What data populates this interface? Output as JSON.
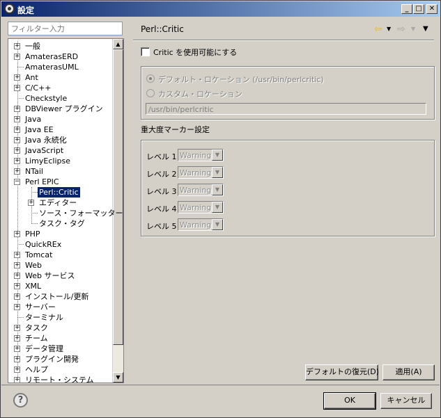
{
  "window": {
    "title": "設定",
    "minimize": "_",
    "maximize": "□",
    "close": "✕"
  },
  "filter": {
    "placeholder": "フィルター入力"
  },
  "tree": {
    "items": [
      {
        "label": "一般",
        "expandable": true
      },
      {
        "label": "AmaterasERD",
        "expandable": true
      },
      {
        "label": "AmaterasUML",
        "expandable": false
      },
      {
        "label": "Ant",
        "expandable": true
      },
      {
        "label": "C/C++",
        "expandable": true
      },
      {
        "label": "Checkstyle",
        "expandable": false
      },
      {
        "label": "DBViewer プラグイン",
        "expandable": true
      },
      {
        "label": "Java",
        "expandable": true
      },
      {
        "label": "Java EE",
        "expandable": true
      },
      {
        "label": "Java 永続化",
        "expandable": true
      },
      {
        "label": "JavaScript",
        "expandable": true
      },
      {
        "label": "LimyEclipse",
        "expandable": true
      },
      {
        "label": "NTail",
        "expandable": true
      },
      {
        "label": "Perl EPIC",
        "expandable": true,
        "expanded": true
      },
      {
        "label": "Perl::Critic",
        "child": true,
        "selected": true
      },
      {
        "label": "エディター",
        "child": true,
        "expandable": true
      },
      {
        "label": "ソース・フォーマッター",
        "child": true
      },
      {
        "label": "タスク・タグ",
        "child": true
      },
      {
        "label": "PHP",
        "expandable": true
      },
      {
        "label": "QuickREx",
        "expandable": false
      },
      {
        "label": "Tomcat",
        "expandable": true
      },
      {
        "label": "Web",
        "expandable": true
      },
      {
        "label": "Web サービス",
        "expandable": true
      },
      {
        "label": "XML",
        "expandable": true
      },
      {
        "label": "インストール/更新",
        "expandable": true
      },
      {
        "label": "サーバー",
        "expandable": true
      },
      {
        "label": "ターミナル",
        "expandable": false
      },
      {
        "label": "タスク",
        "expandable": true
      },
      {
        "label": "チーム",
        "expandable": true
      },
      {
        "label": "データ管理",
        "expandable": true
      },
      {
        "label": "プラグイン開発",
        "expandable": true
      },
      {
        "label": "ヘルプ",
        "expandable": true
      },
      {
        "label": "リモート・システム",
        "expandable": true
      }
    ]
  },
  "page": {
    "title": "Perl::Critic",
    "enable_label": "Critic を使用可能にする",
    "enable_checked": false,
    "location": {
      "default_label": "デフォルト・ロケーション (/usr/bin/perlcritic)",
      "custom_label": "カスタム・ロケーション",
      "path_value": "/usr/bin/perlcritic",
      "selected": "default"
    },
    "severity_title": "重大度マーカー設定",
    "levels": [
      {
        "label": "レベル 1",
        "value": "Warning"
      },
      {
        "label": "レベル 2",
        "value": "Warning"
      },
      {
        "label": "レベル 3",
        "value": "Warning"
      },
      {
        "label": "レベル 4",
        "value": "Warning"
      },
      {
        "label": "レベル 5",
        "value": "Warning"
      }
    ],
    "restore_defaults": "デフォルトの復元(D)",
    "apply": "適用(A)"
  },
  "footer": {
    "help": "?",
    "ok": "OK",
    "cancel": "キャンセル"
  }
}
